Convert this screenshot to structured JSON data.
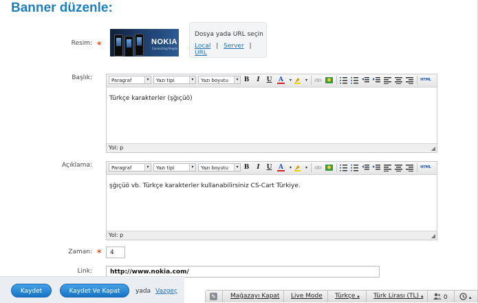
{
  "page": {
    "title": "Banner düzenle:"
  },
  "image_field": {
    "label": "Resim:",
    "thumb_logo": "NOKIA",
    "thumb_sub": "Connecting People",
    "box_title": "Dosya yada URL seçin",
    "links": {
      "local": "Local",
      "server": "Server",
      "url": "URL"
    },
    "sep": "|"
  },
  "toolbar": {
    "format": "Paragraf",
    "font": "Yazı tipi",
    "size": "Yazı boyutu",
    "bold": "B",
    "italic": "I",
    "underline": "U",
    "fontcolor": "A",
    "html": "HTML",
    "dd": "▾"
  },
  "title_field": {
    "label": "Başlık:",
    "content": "Türkçe karakterler (şğıçüö)",
    "path": "Yol: p"
  },
  "desc_field": {
    "label": "Açıklama:",
    "content": "şğıçüö vb. Türkçe karakterler kullanabilirsiniz CS-Cart Türkiye.",
    "path": "Yol: p"
  },
  "time_field": {
    "label": "Zaman:",
    "value": "4"
  },
  "link_field": {
    "label": "Link:",
    "value": "http://www.nokia.com/"
  },
  "required_mark": "*",
  "actions": {
    "save": "Kaydet",
    "save_close": "Kaydet Ve Kapat",
    "or": "yada",
    "cancel": "Vazgeç"
  },
  "bottom_bar": {
    "close_store": "Mağazayı Kapat",
    "live_mode": "Live Mode",
    "language": "Türkçe",
    "currency": "Türk Lirası (TL)",
    "users_count": "0",
    "caret": "▴"
  }
}
